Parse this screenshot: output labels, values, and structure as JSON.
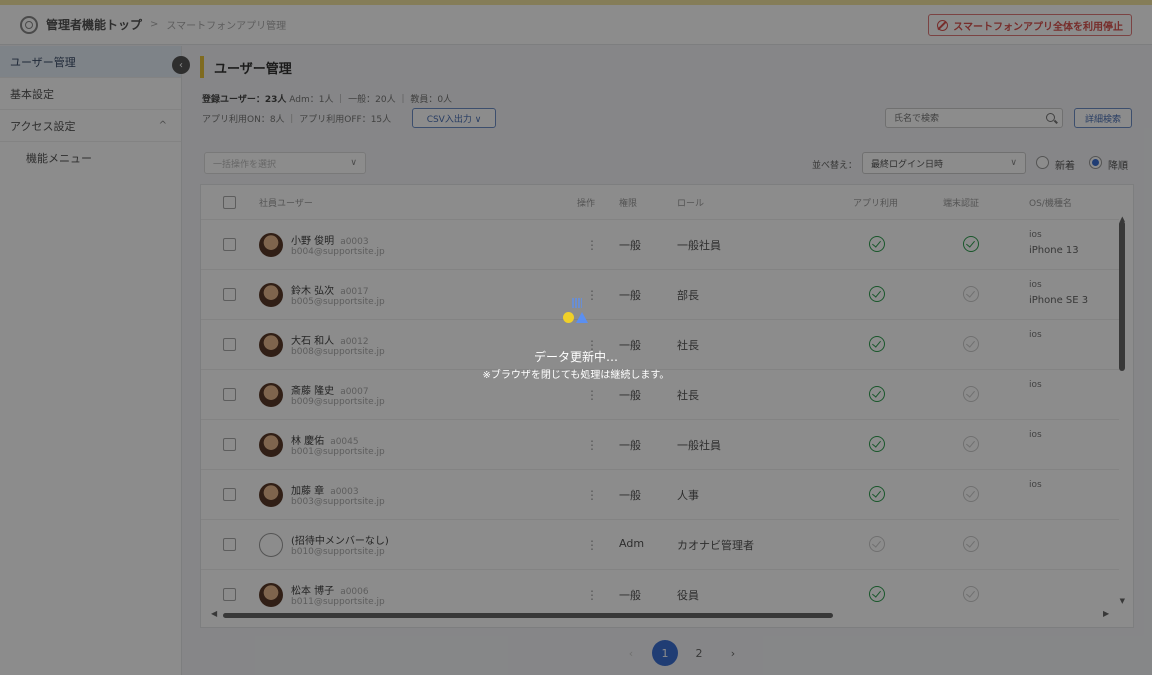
{
  "header": {
    "breadcrumb_top": "管理者機能トップ",
    "breadcrumb_sep": ">",
    "breadcrumb_current": "スマートフォンアプリ管理",
    "ban_button": "スマートフォンアプリ全体を利用停止"
  },
  "sidebar": {
    "collapse_icon": "‹",
    "items": [
      {
        "label": "ユーザー管理"
      },
      {
        "label": "基本設定"
      },
      {
        "label": "アクセス設定",
        "caret": "^"
      },
      {
        "label": "機能メニュー"
      }
    ]
  },
  "page": {
    "title": "ユーザー管理",
    "stats_registered": "登録ユーザー：23人",
    "stats_breakdown": "Adm：1人 ｜ 一般：20人 ｜ 教員：0人",
    "stats_app": "アプリ利用ON：8人 ｜ アプリ利用OFF：15人",
    "csv_button": "CSV入出力 ∨",
    "search_placeholder": "氏名で検索",
    "detail_search_button": "詳細検索",
    "filter_placeholder": "一括操作を選択",
    "filter_chevron": "∨",
    "sort_label": "並べ替え：",
    "sort_value": "最終ログイン日時",
    "sort_new": "新着",
    "sort_old": "降順"
  },
  "table": {
    "headers": {
      "user": "社員ユーザー",
      "action": "操作",
      "perm": "権限",
      "role": "ロール",
      "app": "アプリ利用",
      "device": "端末認証",
      "os": "OS/機種名"
    },
    "kebab": "⋮",
    "rows": [
      {
        "name": "小野 俊明",
        "id": "a0003",
        "email": "b004@supportsite.jp",
        "perm": "一般",
        "role": "一般社員",
        "os": "ios",
        "model": "iPhone 13"
      },
      {
        "name": "鈴木 弘次",
        "id": "a0017",
        "email": "b005@supportsite.jp",
        "perm": "一般",
        "role": "部長",
        "os": "ios",
        "model": "iPhone SE 3"
      },
      {
        "name": "大石 和人",
        "id": "a0012",
        "email": "b008@supportsite.jp",
        "perm": "一般",
        "role": "社長",
        "os": "ios",
        "model": ""
      },
      {
        "name": "斎藤 隆史",
        "id": "a0007",
        "email": "b009@supportsite.jp",
        "perm": "一般",
        "role": "社長",
        "os": "ios",
        "model": ""
      },
      {
        "name": "林 慶佑",
        "id": "a0045",
        "email": "b001@supportsite.jp",
        "perm": "一般",
        "role": "一般社員",
        "os": "ios",
        "model": ""
      },
      {
        "name": "加藤 章",
        "id": "a0003",
        "email": "b003@supportsite.jp",
        "perm": "一般",
        "role": "人事",
        "os": "ios",
        "model": ""
      },
      {
        "name": "(招待中メンバーなし)",
        "id": "",
        "email": "b010@supportsite.jp",
        "perm": "Adm",
        "role": "カオナビ管理者",
        "os": "",
        "model": ""
      },
      {
        "name": "松本 博子",
        "id": "a0006",
        "email": "b011@supportsite.jp",
        "perm": "一般",
        "role": "役員",
        "os": "",
        "model": ""
      }
    ]
  },
  "pager": {
    "prev": "‹",
    "pages": [
      "1",
      "2"
    ],
    "next": "›"
  },
  "loading": {
    "message": "データ更新中…",
    "sub": "※ブラウザを閉じても処理は継続します。"
  }
}
